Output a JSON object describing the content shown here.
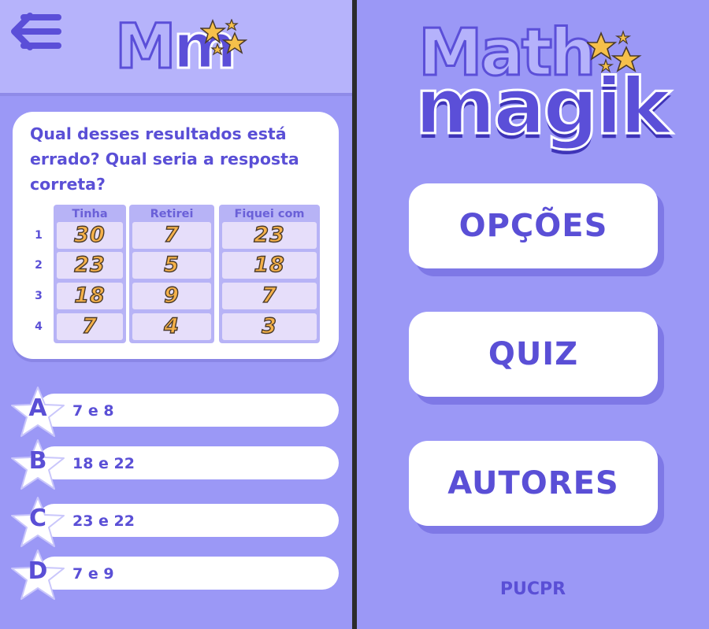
{
  "quiz_screen": {
    "logo_letters": [
      "M",
      "m"
    ],
    "question": "Qual desses resultados está errado? Qual seria a resposta correta?",
    "table": {
      "headers": [
        "Tinha",
        "Retirei",
        "Fiquei com"
      ],
      "row_numbers": [
        "1",
        "2",
        "3",
        "4"
      ],
      "rows": [
        [
          "30",
          "7",
          "23"
        ],
        [
          "23",
          "5",
          "18"
        ],
        [
          "18",
          "9",
          "7"
        ],
        [
          "7",
          "4",
          "3"
        ]
      ]
    },
    "answers": [
      {
        "letter": "A",
        "text": "7 e 8"
      },
      {
        "letter": "B",
        "text": "18 e 22"
      },
      {
        "letter": "C",
        "text": "23 e 22"
      },
      {
        "letter": "D",
        "text": "7 e 9"
      }
    ]
  },
  "menu_screen": {
    "logo_line1": "Math",
    "logo_line2": "magik",
    "buttons": [
      "OPÇÕES",
      "QUIZ",
      "AUTORES"
    ],
    "footer": "PUCPR"
  },
  "colors": {
    "background": "#9b98f6",
    "header": "#b6b3fb",
    "primary": "#5a4fd6",
    "star": "#f6c04a",
    "cell": "#e6defa"
  }
}
